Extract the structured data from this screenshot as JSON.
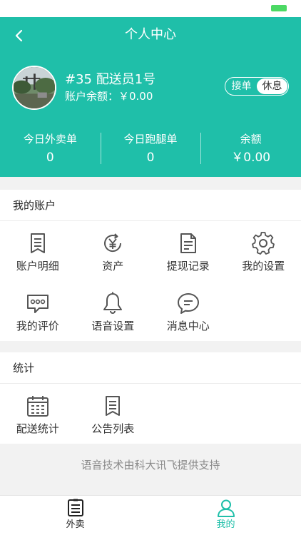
{
  "header": {
    "title": "个人中心",
    "courier_name": "#35 配送员1号",
    "balance_line": "账户余额：￥0.00",
    "toggle": {
      "options": [
        "接单",
        "休息"
      ],
      "selected": "休息"
    },
    "stats": [
      {
        "label": "今日外卖单",
        "value": "0"
      },
      {
        "label": "今日跑腿单",
        "value": "0"
      },
      {
        "label": "余额",
        "value": "￥0.00"
      }
    ]
  },
  "account": {
    "title": "我的账户",
    "items": [
      {
        "label": "账户明细",
        "icon": "bookmark-list-icon"
      },
      {
        "label": "资产",
        "icon": "yen-cycle-icon"
      },
      {
        "label": "提现记录",
        "icon": "document-icon"
      },
      {
        "label": "我的设置",
        "icon": "gear-icon"
      },
      {
        "label": "我的评价",
        "icon": "comment-icon"
      },
      {
        "label": "语音设置",
        "icon": "bell-icon"
      },
      {
        "label": "消息中心",
        "icon": "message-icon"
      }
    ]
  },
  "stats_section": {
    "title": "统计",
    "items": [
      {
        "label": "配送统计",
        "icon": "calendar-icon"
      },
      {
        "label": "公告列表",
        "icon": "bookmark-list-icon"
      }
    ]
  },
  "footer_note": "语音技术由科大讯飞提供支持",
  "tabbar": {
    "tabs": [
      {
        "label": "外卖",
        "icon": "list-icon",
        "active": false
      },
      {
        "label": "我的",
        "icon": "user-icon",
        "active": true
      }
    ]
  },
  "colors": {
    "primary": "#1fbfa9",
    "icon": "#555555",
    "active_tab": "#1fbfa9"
  }
}
